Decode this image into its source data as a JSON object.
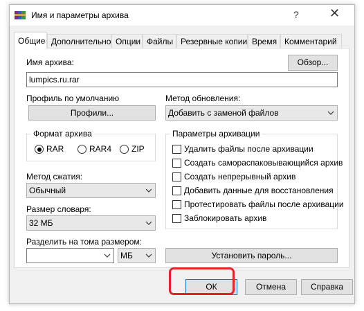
{
  "window": {
    "title": "Имя и параметры архива",
    "help_glyph": "?",
    "close_glyph": "✕"
  },
  "tabs": [
    {
      "label": "Общие",
      "active": true
    },
    {
      "label": "Дополнительно"
    },
    {
      "label": "Опции"
    },
    {
      "label": "Файлы"
    },
    {
      "label": "Резервные копии"
    },
    {
      "label": "Время"
    },
    {
      "label": "Комментарий"
    }
  ],
  "general": {
    "archive_name_label": "Имя архива:",
    "browse_button": "Обзор...",
    "archive_name_value": "lumpics.ru.rar",
    "default_profile_label": "Профиль по умолчанию",
    "profiles_button": "Профили...",
    "update_method_label": "Метод обновления:",
    "update_method_value": "Добавить с заменой файлов",
    "archive_format_title": "Формат архива",
    "formats": [
      {
        "label": "RAR",
        "selected": true
      },
      {
        "label": "RAR4",
        "selected": false
      },
      {
        "label": "ZIP",
        "selected": false
      }
    ],
    "compression_method_label": "Метод сжатия:",
    "compression_method_value": "Обычный",
    "dictionary_size_label": "Размер словаря:",
    "dictionary_size_value": "32 МБ",
    "split_label": "Разделить на тома размером:",
    "split_value": "",
    "split_unit": "МБ",
    "set_password_button": "Установить пароль...",
    "archiving_options_title": "Параметры архивации",
    "options": [
      {
        "label": "Удалить файлы после архивации",
        "checked": false
      },
      {
        "label": "Создать самораспаковывающийся архив",
        "checked": false
      },
      {
        "label": "Создать непрерывный архив",
        "checked": false
      },
      {
        "label": "Добавить данные для восстановления",
        "checked": false
      },
      {
        "label": "Протестировать файлы после архивации",
        "checked": false
      },
      {
        "label": "Заблокировать архив",
        "checked": false
      }
    ]
  },
  "footer": {
    "ok_button": "ОК",
    "cancel_button": "Отмена",
    "help_button": "Справка"
  },
  "colors": {
    "highlight": "#e32329",
    "window_bg": "#f0f0f0",
    "panel_bg": "#ffffff"
  }
}
